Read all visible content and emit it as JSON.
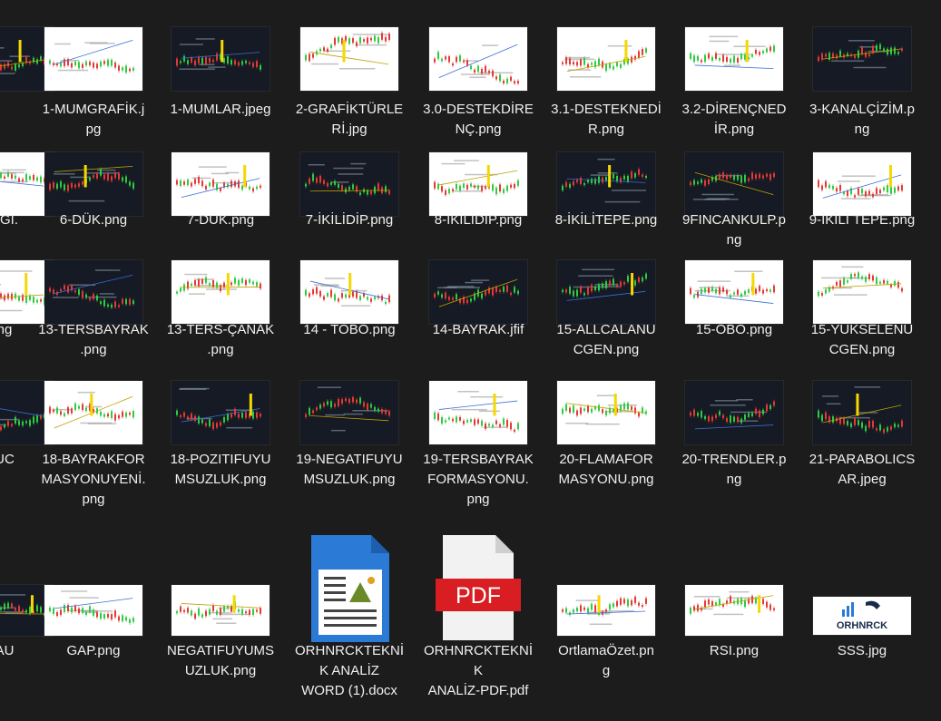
{
  "colors": {
    "background": "#1c1c1c",
    "text": "#f0f0f0",
    "dark_thumb": "#151a24",
    "light_thumb": "#ffffff",
    "candle_green": "#2ecc40",
    "candle_red": "#e53935",
    "highlight_yellow": "#f5d800",
    "word_blue": "#2b7bd6",
    "pdf_red": "#d81e23"
  },
  "files": [
    {
      "id": "r1c0",
      "label": "",
      "thumb": "dark",
      "icon": "image-thumbnail-icon"
    },
    {
      "id": "r1c1",
      "label": "1-MUMGRAFİK.jpg",
      "thumb": "light",
      "icon": "candlestick-chart-thumbnail-icon"
    },
    {
      "id": "r1c2",
      "label": "1-MUMLAR.jpeg",
      "thumb": "dark",
      "icon": "candlestick-chart-thumbnail-icon"
    },
    {
      "id": "r1c3",
      "label": "2-GRAFİKTÜRLERİ.jpg",
      "thumb": "light",
      "icon": "chart-types-thumbnail-icon"
    },
    {
      "id": "r1c4",
      "label": "3.0-DESTEKDİRENÇ.png",
      "thumb": "light",
      "icon": "support-resistance-thumbnail-icon"
    },
    {
      "id": "r1c5",
      "label": "3.1-DESTEKNEDİR.png",
      "thumb": "light",
      "icon": "support-thumbnail-icon"
    },
    {
      "id": "r1c6",
      "label": "3.2-DİRENÇNEDİR.png",
      "thumb": "light",
      "icon": "resistance-thumbnail-icon"
    },
    {
      "id": "r1c7",
      "label": "3-KANALÇİZİM.png",
      "thumb": "dark",
      "icon": "channel-thumbnail-icon"
    },
    {
      "id": "r2c0",
      "label": "AGI.",
      "thumb": "light",
      "icon": "image-thumbnail-icon"
    },
    {
      "id": "r2c1",
      "label": "6-DÜK.png",
      "thumb": "dark",
      "icon": "trend-thumbnail-icon"
    },
    {
      "id": "r2c2",
      "label": "7-DÜK.png",
      "thumb": "light",
      "icon": "trend-thumbnail-icon"
    },
    {
      "id": "r2c3",
      "label": "7-İKİLİDİP.png",
      "thumb": "dark",
      "icon": "double-bottom-thumbnail-icon"
    },
    {
      "id": "r2c4",
      "label": "8-İKİLİDİP.png",
      "thumb": "light",
      "icon": "double-bottom-thumbnail-icon"
    },
    {
      "id": "r2c5",
      "label": "8-İKİLİTEPE.png",
      "thumb": "dark",
      "icon": "double-top-thumbnail-icon"
    },
    {
      "id": "r2c6",
      "label": "9FINCANKULP.png",
      "thumb": "dark",
      "icon": "cup-handle-thumbnail-icon"
    },
    {
      "id": "r2c7",
      "label": "9-İKİLİ TEPE.png",
      "thumb": "light",
      "icon": "double-top-thumbnail-icon"
    },
    {
      "id": "r3c0",
      "label": "ng",
      "thumb": "light",
      "icon": "image-thumbnail-icon"
    },
    {
      "id": "r3c1",
      "label": "13-TERSBAYRAK.png",
      "thumb": "dark",
      "icon": "flag-thumbnail-icon"
    },
    {
      "id": "r3c2",
      "label": "13-TERS-ÇANAK.png",
      "thumb": "light",
      "icon": "bowl-thumbnail-icon"
    },
    {
      "id": "r3c3",
      "label": "14 - TOBO.png",
      "thumb": "light",
      "icon": "head-shoulders-thumbnail-icon"
    },
    {
      "id": "r3c4",
      "label": "14-BAYRAK.jfif",
      "thumb": "dark",
      "icon": "flag-thumbnail-icon"
    },
    {
      "id": "r3c5",
      "label": "15-ALLCALANUCGEN.png",
      "thumb": "dark",
      "icon": "triangle-thumbnail-icon"
    },
    {
      "id": "r3c6",
      "label": "15-OBO.png",
      "thumb": "light",
      "icon": "head-shoulders-thumbnail-icon"
    },
    {
      "id": "r3c7",
      "label": "15-YUKSELENUCGEN.png",
      "thumb": "light",
      "icon": "triangle-thumbnail-icon"
    },
    {
      "id": "r4c0",
      "label": "UC",
      "thumb": "dark",
      "icon": "image-thumbnail-icon"
    },
    {
      "id": "r4c1",
      "label": "18-BAYRAKFORMASYONUYENİ.png",
      "thumb": "light",
      "icon": "flag-thumbnail-icon"
    },
    {
      "id": "r4c2",
      "label": "18-POZITIFUYUMSUZLUK.png",
      "thumb": "dark",
      "icon": "divergence-thumbnail-icon"
    },
    {
      "id": "r4c3",
      "label": "19-NEGATIFUYUMSUZLUK.png",
      "thumb": "dark",
      "icon": "divergence-thumbnail-icon"
    },
    {
      "id": "r4c4",
      "label": "19-TERSBAYRAKFORMASYONU.png",
      "thumb": "light",
      "icon": "flag-thumbnail-icon"
    },
    {
      "id": "r4c5",
      "label": "20-FLAMAFORMASYONU.png",
      "thumb": "light",
      "icon": "pennant-thumbnail-icon"
    },
    {
      "id": "r4c6",
      "label": "20-TRENDLER.png",
      "thumb": "dark",
      "icon": "trend-thumbnail-icon"
    },
    {
      "id": "r4c7",
      "label": "21-PARABOLICSAR.jpeg",
      "thumb": "dark",
      "icon": "parabolic-sar-thumbnail-icon"
    },
    {
      "id": "r5c0",
      "label": "AU",
      "thumb": "dark",
      "icon": "image-thumbnail-icon"
    },
    {
      "id": "r5c1",
      "label": "GAP.png",
      "thumb": "light",
      "icon": "gap-thumbnail-icon"
    },
    {
      "id": "r5c2",
      "label": "NEGATIFUYUMSUZLUK.png",
      "thumb": "light",
      "icon": "divergence-thumbnail-icon"
    },
    {
      "id": "r5c3",
      "label": "ORHNRCKTEKNİK ANALİZ WORD (1).docx",
      "thumb": "word",
      "icon": "word-document-icon"
    },
    {
      "id": "r5c4",
      "label": "ORHNRCKTEKNİK ANALİZ-PDF.pdf",
      "thumb": "pdf",
      "icon": "pdf-document-icon",
      "pdf_text": "PDF"
    },
    {
      "id": "r5c5",
      "label": "OrtlamaÖzet.png",
      "thumb": "light",
      "icon": "moving-average-thumbnail-icon"
    },
    {
      "id": "r5c6",
      "label": "RSI.png",
      "thumb": "light",
      "icon": "rsi-thumbnail-icon"
    },
    {
      "id": "r5c7",
      "label": "SSS.jpg",
      "thumb": "logo",
      "icon": "orhnrck-logo-icon",
      "logo_text": "ORHNRCK"
    }
  ]
}
